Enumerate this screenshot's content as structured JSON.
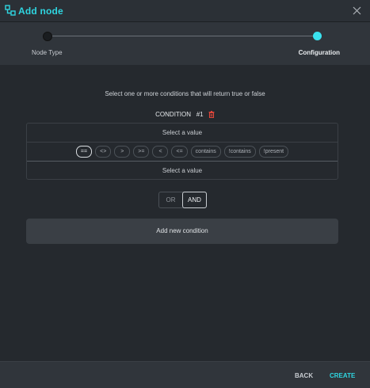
{
  "header": {
    "title": "Add node",
    "icon": "node-graph-icon",
    "close_icon": "close-icon",
    "accent_color": "#2fd5e0"
  },
  "stepper": {
    "steps": [
      {
        "label": "Node Type",
        "state": "completed"
      },
      {
        "label": "Configuration",
        "state": "active"
      }
    ]
  },
  "main": {
    "instruction": "Select one or more conditions that will return true or false",
    "condition": {
      "title": "CONDITION",
      "number": "#1",
      "left_placeholder": "Select a value",
      "right_placeholder": "Select a value",
      "operators": [
        "==",
        "<>",
        ">",
        ">=",
        "<",
        "<=",
        "contains",
        "!contains",
        "!present"
      ],
      "selected_operator": "=="
    },
    "logic_toggle": {
      "options": [
        "OR",
        "AND"
      ],
      "selected": "AND"
    },
    "add_condition_label": "Add new condition"
  },
  "footer": {
    "back_label": "BACK",
    "create_label": "CREATE"
  }
}
